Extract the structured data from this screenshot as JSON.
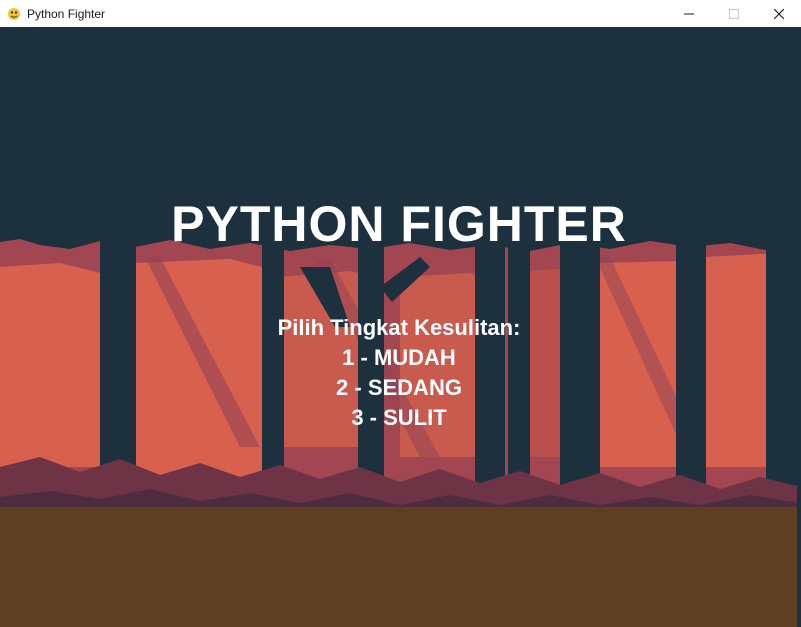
{
  "window": {
    "title": "Python Fighter",
    "icon": "pygame-snake-icon",
    "controls": [
      "minimize-icon",
      "maximize-icon",
      "close-icon"
    ]
  },
  "game": {
    "title": "PYTHON FIGHTER",
    "prompt": "Pilih Tingkat Kesulitan:",
    "options": [
      {
        "label": "1 - MUDAH"
      },
      {
        "label": "2 - SEDANG"
      },
      {
        "label": "3 - SULIT"
      }
    ]
  },
  "colors": {
    "sky": "#1c313d",
    "forest_light": "#d8604f",
    "forest_mid": "#a24752",
    "forest_dark": "#6e3446",
    "tree_trunk": "#1c313d",
    "ground": "#5f3f22",
    "text": "#ffffff"
  }
}
